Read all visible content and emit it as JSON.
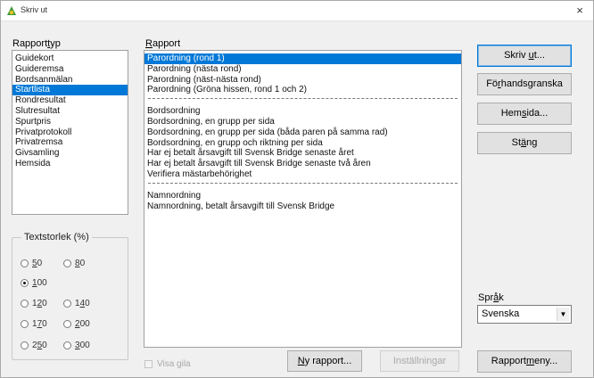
{
  "window": {
    "title": "Skriv ut",
    "close_glyph": "×"
  },
  "report_type": {
    "label_pre": "Rapport",
    "label_key": "t",
    "label_post": "yp",
    "items": [
      {
        "label": "Guidekort",
        "selected": false
      },
      {
        "label": "Guideremsa",
        "selected": false
      },
      {
        "label": "Bordsanmälan",
        "selected": false
      },
      {
        "label": "Startlista",
        "selected": true
      },
      {
        "label": "Rondresultat",
        "selected": false
      },
      {
        "label": "Slutresultat",
        "selected": false
      },
      {
        "label": "Spurtpris",
        "selected": false
      },
      {
        "label": "Privatprotokoll",
        "selected": false
      },
      {
        "label": "Privatremsa",
        "selected": false
      },
      {
        "label": "Givsamling",
        "selected": false
      },
      {
        "label": "Hemsida",
        "selected": false
      }
    ]
  },
  "report": {
    "label_key": "R",
    "label_post": "apport",
    "groups": [
      [
        "Parordning (rond 1)",
        "Parordning (nästa rond)",
        "Parordning (näst-nästa rond)",
        "Parordning (Gröna hissen, rond 1 och 2)"
      ],
      [
        "Bordsordning",
        "Bordsordning, en grupp per sida",
        "Bordsordning, en grupp per sida (båda paren på samma rad)",
        "Bordsordning, en grupp och riktning per sida",
        "Har ej betalt årsavgift till Svensk Bridge senaste året",
        "Har ej betalt årsavgift till Svensk Bridge senaste två åren",
        "Verifiera mästarbehörighet"
      ],
      [
        "Namnordning",
        "Namnordning, betalt årsavgift till Svensk Bridge"
      ]
    ],
    "selected": "Parordning (rond 1)"
  },
  "text_size": {
    "legend": "Textstorlek (%)",
    "options": [
      {
        "pre": "",
        "key": "5",
        "post": "0",
        "checked": false
      },
      {
        "pre": "",
        "key": "8",
        "post": "0",
        "checked": false
      },
      {
        "pre": "",
        "key": "1",
        "post": "00",
        "checked": true
      },
      {
        "pre": "1",
        "key": "2",
        "post": "0",
        "checked": false
      },
      {
        "pre": "1",
        "key": "4",
        "post": "0",
        "checked": false
      },
      {
        "pre": "1",
        "key": "7",
        "post": "0",
        "checked": false
      },
      {
        "pre": "",
        "key": "2",
        "post": "00",
        "checked": false
      },
      {
        "pre": "2",
        "key": "5",
        "post": "0",
        "checked": false
      },
      {
        "pre": "",
        "key": "3",
        "post": "00",
        "checked": false
      }
    ]
  },
  "checkbox_show_pts": {
    "label": "Visa gila",
    "checked": false,
    "enabled": false
  },
  "buttons": {
    "print": {
      "pre": "Skriv ",
      "key": "u",
      "post": "t..."
    },
    "preview": {
      "pre": "Fö",
      "key": "r",
      "post": "handsgranska"
    },
    "homepage": {
      "pre": "Hem",
      "key": "s",
      "post": "ida..."
    },
    "close": {
      "pre": "St",
      "key": "ä",
      "post": "ng"
    },
    "new_report": {
      "pre": "",
      "key": "N",
      "post": "y rapport..."
    },
    "settings": {
      "label": "Inställningar"
    },
    "report_menu": {
      "pre": "Rapport",
      "key": "m",
      "post": "eny..."
    }
  },
  "language": {
    "label_pre": "Spr",
    "label_key": "å",
    "label_post": "k",
    "value": "Svenska"
  },
  "colors": {
    "selection": "#0078d7",
    "app_icon_green": "#3a9a3a",
    "app_icon_yellow": "#e8c020"
  },
  "icons": {
    "app": "bridge-app-icon",
    "close": "close-icon",
    "dropdown": "chevron-down-icon"
  }
}
